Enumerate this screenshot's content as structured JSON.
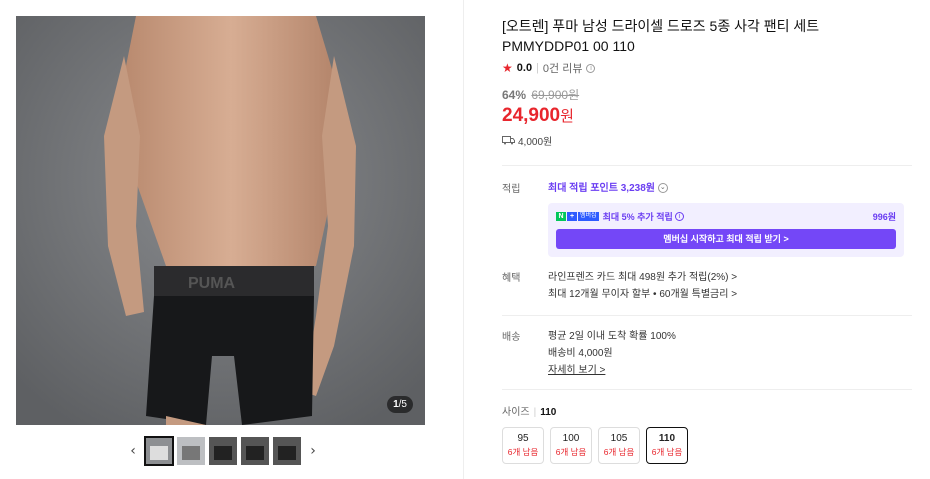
{
  "gallery": {
    "counter_current": "1",
    "counter_total": "/5",
    "brand_text": "PUMA",
    "prev_arrow": "‹",
    "next_arrow": "›",
    "thumb_count": 5
  },
  "product": {
    "title_line1": "[오트렌] 푸마 남성 드라이셀 드로즈 5종 사각 팬티 세트",
    "title_line2": "PMMYDDP01 00 110",
    "rating_score": "0.0",
    "review_count": "0건 리뷰",
    "discount": "64%",
    "original_price": "69,900원",
    "price_value": "24,900",
    "price_unit": "원",
    "shipping_fee": "4,000원"
  },
  "points": {
    "label": "적립",
    "max_points_text": "최대 적립 포인트",
    "max_points_value": "3,238원",
    "membership_text": "최대 5% 추가 적립",
    "membership_amount": "996원",
    "n_badge": "N",
    "plus_badge": "+",
    "membership_badge": "멤버십",
    "membership_button": "멤버십 시작하고 최대 적립 받기 >"
  },
  "benefits": {
    "label": "혜택",
    "line1": "라인프렌즈 카드 최대 498원 추가 적립(2%) >",
    "line2": "최대 12개월 무이자 할부 • 60개월 특별금리 >"
  },
  "delivery": {
    "label": "배송",
    "line1": "평균 2일 이내 도착 확률 100%",
    "line2": "배송비 4,000원",
    "more_link": "자세히 보기 >"
  },
  "size": {
    "label": "사이즈",
    "selected": "110",
    "options": [
      {
        "size": "95",
        "stock": "6개 남음"
      },
      {
        "size": "100",
        "stock": "6개 남음"
      },
      {
        "size": "105",
        "stock": "6개 남음"
      },
      {
        "size": "110",
        "stock": "6개 남음"
      }
    ]
  },
  "colors": {
    "accent_red": "#e8262d",
    "accent_purple": "#6a3df2",
    "membership_button": "#7447f7"
  }
}
